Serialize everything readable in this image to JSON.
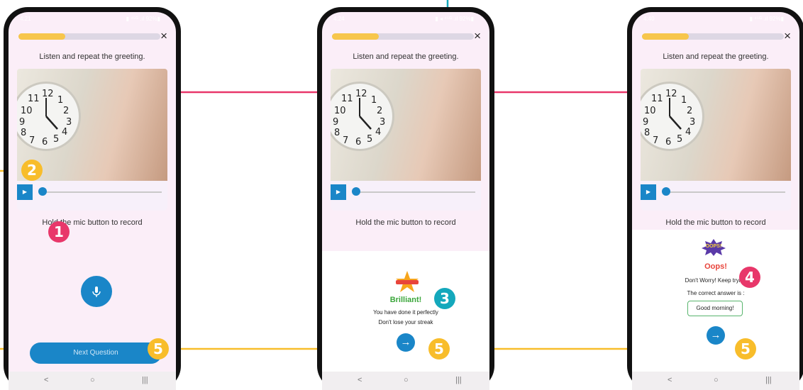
{
  "colors": {
    "accent_blue": "#1a86c8",
    "progress_yellow": "#f7c64c",
    "marker_pink": "#e8376a",
    "marker_yellow": "#f8bd2b",
    "marker_teal": "#14a8bc",
    "success_green": "#3aa63a",
    "error_red": "#e8443b"
  },
  "markers": {
    "m1": "1",
    "m2": "2",
    "m3": "3",
    "m4": "4",
    "m5": "5"
  },
  "screens": [
    {
      "status_time": "4:21",
      "status_icons": "▮ ⁴⁵ᴳ .ıl 92%▮",
      "progress": 0.33,
      "close_label": "×",
      "prompt": "Listen and repeat the greeting.",
      "play_label": "▶",
      "record_hint": "Hold the mic button to record",
      "mic_icon": "mic-icon",
      "next_label": "Next Question",
      "nav": {
        "back": "<",
        "home": "○",
        "recent": "|||"
      }
    },
    {
      "status_time": "4:24",
      "status_icons": "▮ ◂ ⁴⁵ᴳ .ıl 92%▮",
      "progress": 0.33,
      "close_label": "×",
      "prompt": "Listen and repeat the greeting.",
      "play_label": "▶",
      "record_hint": "Hold the mic button to record",
      "feedback_title": "Brilliant!",
      "feedback_line1": "You have done it perfectly",
      "feedback_line2": "Don't lose your streak",
      "arrow_label": "→",
      "nav": {
        "back": "<",
        "home": "○",
        "recent": "|||"
      }
    },
    {
      "status_time": "4:40",
      "status_icons": "▮ ⁴⁵ᴳ .ıl 92%▮",
      "progress": 0.33,
      "close_label": "×",
      "prompt": "Listen and repeat the greeting.",
      "play_label": "▶",
      "record_hint": "Hold the mic button to record",
      "oops_badge": "OOPS!",
      "feedback_title": "Oops!",
      "feedback_line1": "Don't Worry! Keep trying",
      "feedback_line2": "The correct answer is :",
      "correct_answer": "Good morning!",
      "arrow_label": "→",
      "nav": {
        "back": "<",
        "home": "○",
        "recent": "|||"
      }
    }
  ]
}
